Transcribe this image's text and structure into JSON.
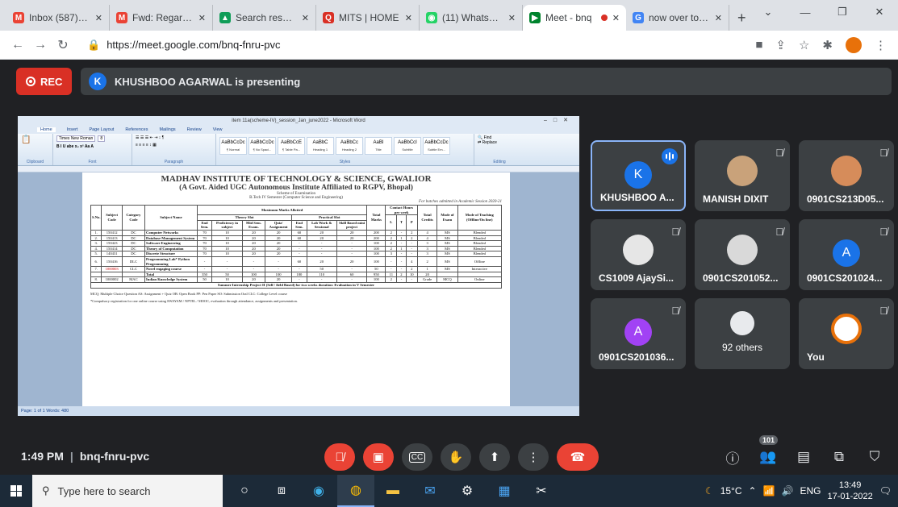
{
  "browser": {
    "tabs": [
      {
        "title": "Inbox (587) - vi",
        "fav": "M",
        "favcolor": "#ea4335",
        "active": false
      },
      {
        "title": "Fwd: Regarding",
        "fav": "M",
        "favcolor": "#ea4335",
        "active": false
      },
      {
        "title": "Search results",
        "fav": "▲",
        "favcolor": "#0f9d58",
        "active": false
      },
      {
        "title": "MITS | HOME",
        "fav": "Q",
        "favcolor": "#d93025",
        "active": false
      },
      {
        "title": "(11) WhatsApp",
        "fav": "◉",
        "favcolor": "#25d366",
        "active": false
      },
      {
        "title": "Meet - bnq",
        "fav": "▶",
        "favcolor": "#00832d",
        "active": true
      },
      {
        "title": "now over to yo",
        "fav": "G",
        "favcolor": "#4285f4",
        "active": false
      }
    ],
    "new_tab": "+",
    "url": "https://meet.google.com/bnq-fnru-pvc"
  },
  "meet": {
    "rec_label": "REC",
    "presenter_initial": "K",
    "presenting_text": "KHUSHBOO AGARWAL is presenting",
    "time": "1:49 PM",
    "meeting_code": "bnq-fnru-pvc",
    "participants_badge": "101",
    "tiles": [
      {
        "name": "KHUSHBOO A...",
        "initial": "K",
        "color": "#1a73e8",
        "speaking": true
      },
      {
        "name": "MANISH DIXIT",
        "photo": true,
        "muted": true
      },
      {
        "name": "0901CS213D05...",
        "photo": true,
        "muted": true
      },
      {
        "name": "CS1009 AjaySi...",
        "photo": true,
        "muted": true
      },
      {
        "name": "0901CS201052...",
        "photo": true,
        "muted": true
      },
      {
        "name": "0901CS201024...",
        "initial": "A",
        "color": "#1a73e8",
        "muted": true
      },
      {
        "name": "0901CS201036...",
        "initial": "A",
        "color": "#a142f4",
        "muted": true
      },
      {
        "others_label": "92 others"
      },
      {
        "name": "You",
        "logo": true,
        "muted": true
      }
    ]
  },
  "word": {
    "title": "item 11a(scheme-IV)_session_Jan_june2022 - Microsoft Word",
    "tabs": [
      "Home",
      "Insert",
      "Page Layout",
      "References",
      "Mailings",
      "Review",
      "View"
    ],
    "font_name": "Times New Roman",
    "font_size": "8",
    "groups": [
      "Clipboard",
      "Font",
      "Paragraph",
      "Styles",
      "Editing"
    ],
    "styles": [
      {
        "sample": "AaBbCcDc",
        "name": "¶ Normal"
      },
      {
        "sample": "AaBbCcDc",
        "name": "¶ No Spaci..."
      },
      {
        "sample": "AaBbCcE",
        "name": "¶ Table Pa..."
      },
      {
        "sample": "AaBbC",
        "name": "Heading 1"
      },
      {
        "sample": "AaBbCc",
        "name": "Heading 2"
      },
      {
        "sample": "AaBI",
        "name": "Title"
      },
      {
        "sample": "AaBbCcI",
        "name": "Subtitle"
      },
      {
        "sample": "AaBbCcDc",
        "name": "Subtle Em..."
      }
    ],
    "status": "Page: 1 of 1    Words: 480",
    "heading1": "MADHAV INSTITUTE OF TECHNOLOGY & SCIENCE, GWALIOR",
    "heading2": "(A Govt. Aided UGC Autonomous Institute Affiliated to RGPV, Bhopal)",
    "heading3a": "Scheme of Examination",
    "heading3b": "B.Tech IV Semester (Computer Science and Engineering)",
    "heading_right": "For batches admitted in Academic Session 2020-21",
    "header_main": [
      "S.No.",
      "Subject Code",
      "Category Code",
      "Subject Name",
      "Maximum Marks Allotted",
      "Total Marks",
      "Contact Hours per week",
      "Total Credits",
      "Mode of Exam",
      "Mode of Teaching (Offline/On line)"
    ],
    "rows": [
      [
        "1.",
        "150412",
        "DC",
        "Computer Networks",
        "70",
        "10",
        "20",
        "20",
        "60",
        "20",
        "20",
        "200",
        "2",
        "-",
        "2",
        "4",
        "MS",
        "Blended"
      ],
      [
        "2.",
        "150413",
        "DC",
        "Database Management System",
        "70",
        "10",
        "20",
        "20",
        "60",
        "20",
        "20",
        "200",
        "2",
        "1",
        "2",
        "4",
        "MS",
        "Blended"
      ],
      [
        "3.",
        "150423",
        "DC",
        "Software Engineering",
        "70",
        "10",
        "20",
        "20",
        "-",
        "-",
        "-",
        "100",
        "2",
        "-",
        "-",
        "3",
        "MS",
        "Blended"
      ],
      [
        "4.",
        "150414",
        "DC",
        "Theory of Computation",
        "70",
        "10",
        "20",
        "20",
        "-",
        "-",
        "-",
        "100",
        "2",
        "1",
        "-",
        "3",
        "MS",
        "Blended"
      ],
      [
        "5.",
        "140431",
        "DC",
        "Discrete Structure",
        "70",
        "10",
        "20",
        "20",
        "-",
        "-",
        "-",
        "100",
        "3",
        "-",
        "-",
        "3",
        "MS",
        "Blended"
      ],
      [
        "6.",
        "150416",
        "DLC",
        "Programming Lab* Python Programming",
        "-",
        "-",
        "-",
        "-",
        "60",
        "20",
        "20",
        "100",
        "-",
        "-",
        "4",
        "2",
        "MS",
        "Offline"
      ],
      [
        "7.",
        "1000003",
        "CLC",
        "Novel engaging course",
        "-",
        "-",
        "-",
        "-",
        "-",
        "50",
        "-",
        "50",
        "-",
        "-",
        "2",
        "1",
        "MS",
        "Interactive"
      ],
      [
        "",
        "",
        "",
        "Total",
        "350",
        "50",
        "100",
        "100",
        "180",
        "110",
        "60",
        "950",
        "11",
        "2",
        "10",
        "20",
        "",
        ""
      ],
      [
        "8.",
        "1000002",
        "MAC",
        "Indian Knowledge System",
        "50",
        "10",
        "20",
        "20",
        "-",
        "-",
        "-",
        "100",
        "2",
        "-",
        "-",
        "Grade",
        "MCQ",
        "Online"
      ]
    ],
    "internship_row": "Summer Internship Project II (Self / field Based) for two weeks duration: Evaluation in V Semester",
    "footnote1": "MCQ: Multiple Choice Question   AS: Assignment + Quiz   OB: Open Book   PP: Pen Paper   SO: Submission Oral   CLC: College Level course",
    "footnote2": "*Compulsory registration for one online course using SWAYAM / NPTEL / MOOC, evaluation through attendance, assignments and presentation."
  },
  "taskbar": {
    "search_placeholder": "Type here to search",
    "weather": "15°C",
    "lang": "ENG",
    "clock_time": "13:49",
    "clock_date": "17-01-2022"
  }
}
